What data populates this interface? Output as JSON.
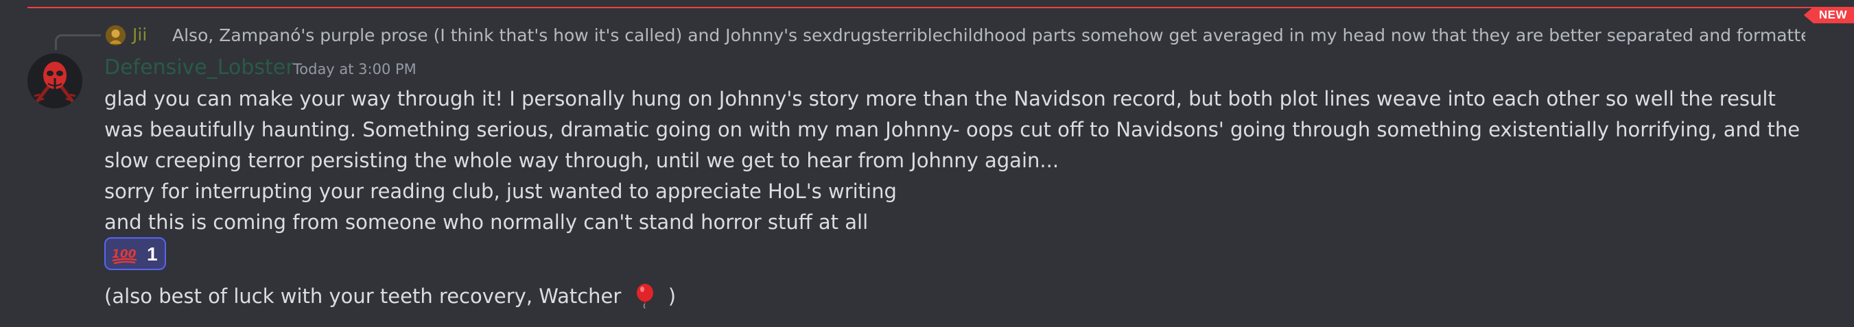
{
  "divider": {
    "new_label": "NEW",
    "color": "#f23f43"
  },
  "reply": {
    "author": "Jii",
    "text": "Also, Zampanó's purple prose (I think that's how it's called) and Johnny's sexdrugsterriblechildhood parts somehow get averaged in my head now that they are better separated and formatted than in the"
  },
  "message": {
    "author": "Defensive_Lobster",
    "timestamp": "Today at 3:00 PM",
    "lines": [
      "glad you can make your way through it! I personally hung on Johnny's story more than the Navidson record, but both plot lines weave into each other so well the result was beautifully haunting. Something serious, dramatic going on with my man Johnny- oops cut off to Navidsons' going through something existentially horrifying, and the slow creeping terror persisting the whole way through, until we get to hear from Johnny again...",
      "sorry for interrupting your reading club, just wanted to appreciate HoL's writing",
      "and this is coming from someone who normally can't stand horror stuff at all"
    ],
    "reaction": {
      "emoji": "hundred-points-icon",
      "count": "1"
    },
    "followup": {
      "before": "(also best of luck with your teeth recovery, Watcher",
      "emoji": "balloon-icon",
      "after": ")"
    }
  }
}
